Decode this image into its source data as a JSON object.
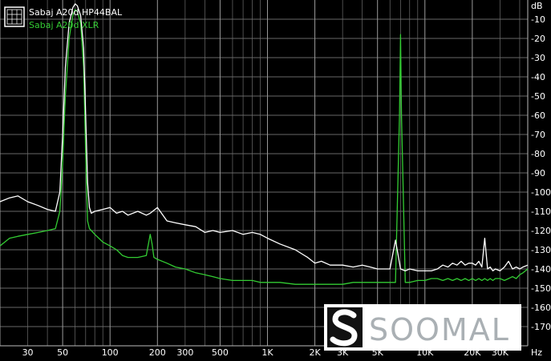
{
  "chart_data": {
    "type": "line",
    "title": "",
    "xlabel": "Hz",
    "ylabel": "dB",
    "xscale": "log",
    "xlim": [
      20,
      45000
    ],
    "ylim": [
      -180,
      0
    ],
    "grid": true,
    "legend_position": "top-left",
    "xticks": [
      {
        "value": 30,
        "label": "30"
      },
      {
        "value": 50,
        "label": "50"
      },
      {
        "value": 100,
        "label": "100"
      },
      {
        "value": 200,
        "label": "200"
      },
      {
        "value": 300,
        "label": "300"
      },
      {
        "value": 500,
        "label": "500"
      },
      {
        "value": 1000,
        "label": "1K"
      },
      {
        "value": 2000,
        "label": "2K"
      },
      {
        "value": 3000,
        "label": "3K"
      },
      {
        "value": 5000,
        "label": "5K"
      },
      {
        "value": 10000,
        "label": "10K"
      },
      {
        "value": 20000,
        "label": "20K"
      },
      {
        "value": 30000,
        "label": "30K"
      }
    ],
    "yticks": [
      {
        "value": -10,
        "label": "-10"
      },
      {
        "value": -20,
        "label": "-20"
      },
      {
        "value": -30,
        "label": "-30"
      },
      {
        "value": -40,
        "label": "-40"
      },
      {
        "value": -50,
        "label": "-50"
      },
      {
        "value": -60,
        "label": "-60"
      },
      {
        "value": -70,
        "label": "-70"
      },
      {
        "value": -80,
        "label": "-80"
      },
      {
        "value": -90,
        "label": "-90"
      },
      {
        "value": -100,
        "label": "-100"
      },
      {
        "value": -110,
        "label": "-110"
      },
      {
        "value": -120,
        "label": "-120"
      },
      {
        "value": -130,
        "label": "-130"
      },
      {
        "value": -140,
        "label": "-140"
      },
      {
        "value": -150,
        "label": "-150"
      },
      {
        "value": -160,
        "label": "-160"
      },
      {
        "value": -170,
        "label": "-170"
      }
    ],
    "series": [
      {
        "name": "Sabaj A20d HP44BAL",
        "color": "#ffffff",
        "x": [
          20,
          23,
          26,
          30,
          35,
          40,
          45,
          48,
          50,
          52,
          55,
          58,
          60,
          62,
          65,
          68,
          70,
          72,
          74,
          76,
          80,
          90,
          100,
          110,
          120,
          130,
          150,
          170,
          180,
          200,
          230,
          260,
          300,
          350,
          400,
          450,
          500,
          600,
          700,
          800,
          900,
          1000,
          1200,
          1500,
          1800,
          2000,
          2200,
          2500,
          3000,
          3500,
          4000,
          4500,
          5000,
          6000,
          6500,
          7000,
          7500,
          8000,
          9000,
          10000,
          11000,
          12000,
          13000,
          14000,
          15000,
          16000,
          17000,
          18000,
          19000,
          20000,
          21000,
          22000,
          23000,
          24000,
          25000,
          26000,
          27000,
          28000,
          30000,
          32000,
          34000,
          36000,
          38000,
          40000,
          42000,
          45000
        ],
        "y": [
          -105,
          -103,
          -102,
          -105,
          -107,
          -109,
          -110,
          -100,
          -70,
          -35,
          -12,
          -4,
          -2,
          -3,
          -8,
          -25,
          -60,
          -95,
          -108,
          -111,
          -110,
          -109,
          -108,
          -111,
          -110,
          -112,
          -110,
          -112,
          -111,
          -108,
          -115,
          -116,
          -117,
          -118,
          -121,
          -120,
          -121,
          -120,
          -122,
          -121,
          -122,
          -124,
          -127,
          -130,
          -134,
          -137,
          -136,
          -138,
          -138,
          -139,
          -138,
          -139,
          -140,
          -140,
          -125,
          -140,
          -141,
          -140,
          -141,
          -141,
          -141,
          -140,
          -138,
          -139,
          -137,
          -138,
          -136,
          -138,
          -137,
          -137,
          -138,
          -136,
          -139,
          -124,
          -140,
          -139,
          -141,
          -140,
          -141,
          -139,
          -136,
          -140,
          -139,
          -140,
          -139,
          -138
        ]
      },
      {
        "name": "Sabaj A20d XLR",
        "color": "#33cc33",
        "x": [
          20,
          23,
          26,
          30,
          35,
          40,
          45,
          48,
          50,
          52,
          55,
          58,
          60,
          62,
          65,
          68,
          70,
          72,
          74,
          76,
          80,
          90,
          100,
          110,
          120,
          130,
          150,
          170,
          180,
          185,
          190,
          200,
          230,
          260,
          300,
          350,
          400,
          450,
          500,
          600,
          700,
          800,
          900,
          1000,
          1200,
          1500,
          1800,
          2000,
          2200,
          2500,
          3000,
          3500,
          4000,
          4500,
          5000,
          6000,
          6500,
          6900,
          7000,
          7100,
          7500,
          8000,
          9000,
          10000,
          11000,
          12000,
          13000,
          14000,
          15000,
          16000,
          17000,
          18000,
          19000,
          20000,
          21000,
          22000,
          23000,
          24000,
          25000,
          26000,
          27000,
          28000,
          30000,
          32000,
          34000,
          36000,
          38000,
          40000,
          42000,
          45000
        ],
        "y": [
          -128,
          -124,
          -123,
          -122,
          -121,
          -120,
          -119,
          -110,
          -85,
          -50,
          -20,
          -8,
          -5,
          -6,
          -12,
          -35,
          -80,
          -115,
          -119,
          -120,
          -122,
          -126,
          -128,
          -130,
          -133,
          -134,
          -134,
          -133,
          -122,
          -127,
          -134,
          -135,
          -137,
          -139,
          -140,
          -142,
          -143,
          -144,
          -145,
          -146,
          -146,
          -146,
          -147,
          -147,
          -147,
          -148,
          -148,
          -148,
          -148,
          -148,
          -148,
          -147,
          -147,
          -147,
          -147,
          -147,
          -147,
          -60,
          -18,
          -60,
          -147,
          -147,
          -146,
          -146,
          -145,
          -145,
          -146,
          -145,
          -146,
          -145,
          -146,
          -145,
          -146,
          -145,
          -146,
          -145,
          -146,
          -145,
          -146,
          -145,
          -146,
          -145,
          -145,
          -146,
          -145,
          -144,
          -145,
          -143,
          -142,
          -140
        ]
      }
    ]
  },
  "watermark": {
    "text": "SOOMAL",
    "background": "#ffffff",
    "text_color": "#aab0b4",
    "logo_color": "#111111"
  }
}
